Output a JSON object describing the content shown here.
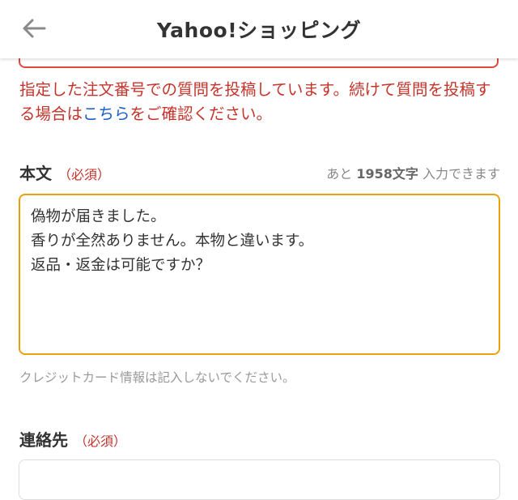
{
  "header": {
    "title": "Yahoo!ショッピング",
    "back_icon": "arrow-left-icon"
  },
  "notice": {
    "text_before": "指定した注文番号での質問を投稿しています。続けて質問を投稿する場合は",
    "link_text": "こちら",
    "text_after": "をご確認ください。",
    "color": "#c4342b",
    "link_color": "#1a5fc7"
  },
  "body_field": {
    "label": "本文",
    "required": "（必須）",
    "count_prefix": "あと",
    "count_value": "1958文字",
    "count_suffix": "入力できます",
    "value": "偽物が届きました。\n香りが全然ありません。本物と違います。\n返品・返金は可能ですか？",
    "border_color": "#e8a20c",
    "hint": "クレジットカード情報は記入しないでください。"
  },
  "contact_field": {
    "label": "連絡先",
    "required": "（必須）",
    "value": ""
  }
}
